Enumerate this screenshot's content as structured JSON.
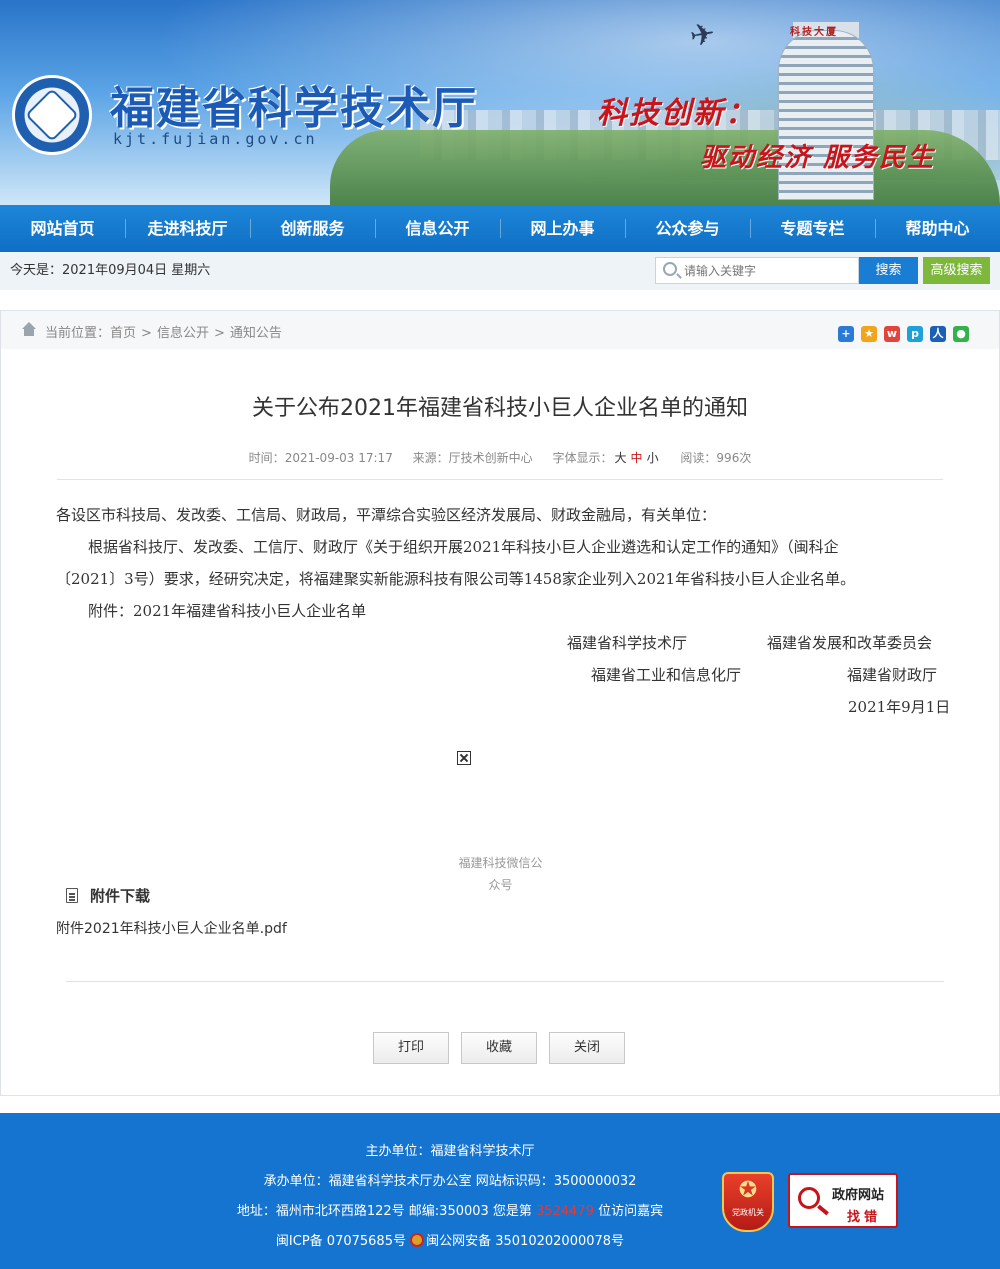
{
  "header": {
    "site_title": "福建省科学技术厅",
    "site_url": "kjt.fujian.gov.cn",
    "tower_sign": "科技大厦",
    "slogan_line1": "科技创新：",
    "slogan_line2": "驱动经济 服务民生"
  },
  "nav": {
    "items": [
      "网站首页",
      "走进科技厅",
      "创新服务",
      "信息公开",
      "网上办事",
      "公众参与",
      "专题专栏",
      "帮助中心"
    ]
  },
  "subbar": {
    "today": "今天是：2021年09月04日  星期六",
    "search_placeholder": "请输入关键字",
    "search_button": "搜索",
    "advanced_button": "高级搜索"
  },
  "breadcrumb": {
    "prefix": "当前位置：",
    "items": [
      "首页",
      "信息公开",
      "通知公告"
    ],
    "separator": ">"
  },
  "share": {
    "icons": [
      "share-plus-icon",
      "qzone-icon",
      "weibo-icon",
      "tencent-weibo-icon",
      "renren-icon",
      "wechat-icon"
    ],
    "colors": [
      "#2a7ad6",
      "#f2a41c",
      "#e0443a",
      "#1ea0d8",
      "#1c5fb6",
      "#35b14b"
    ]
  },
  "article": {
    "title": "关于公布2021年福建省科技小巨人企业名单的通知",
    "time_label": "时间：",
    "time": "2021-09-03 17:17",
    "source_label": "来源：",
    "source": "厅技术创新中心",
    "font_label": "字体显示：",
    "font_sizes": [
      "大",
      "中",
      "小"
    ],
    "reads_label": "阅读：",
    "reads": "996次",
    "para1": "各设区市科技局、发改委、工信局、财政局，平潭综合实验区经济发展局、财政金融局，有关单位：",
    "para2_line1": "根据省科技厅、发改委、工信厅、财政厅《关于组织开展2021年科技小巨人企业遴选和认定工作的通知》（闽科企",
    "para2_line2": "〔2021〕3号）要求，经研究决定，将福建聚实新能源科技有限公司等1458家企业列入2021年省科技小巨人企业名单。",
    "para3": "附件：2021年福建省科技小巨人企业名单",
    "signers": [
      "福建省科学技术厅",
      "福建省发展和改革委员会",
      "福建省工业和信息化厅",
      "福建省财政厅"
    ],
    "date": "2021年9月1日",
    "qr_caption_line1": "福建科技微信公",
    "qr_caption_line2": "众号"
  },
  "attachments": {
    "heading": "附件下载",
    "files": [
      "附件2021年科技小巨人企业名单.pdf"
    ]
  },
  "actions": {
    "print": "打印",
    "favorite": "收藏",
    "close": "关闭"
  },
  "footer": {
    "host": "主办单位：福建省科学技术厅",
    "organizer": "承办单位：福建省科学技术厅办公室 网站标识码：3500000032",
    "address_prefix": "地址：福州市北环西路122号 邮编:350003 您是第",
    "visits": "3524479",
    "address_suffix": "位访问嘉宾",
    "icp": "闽ICP备 07075685号",
    "police": "闽公网安备 35010202000078号",
    "party_badge": "党政机关",
    "gov_badge_line1": "政府网站",
    "gov_badge_line2": "找错"
  }
}
